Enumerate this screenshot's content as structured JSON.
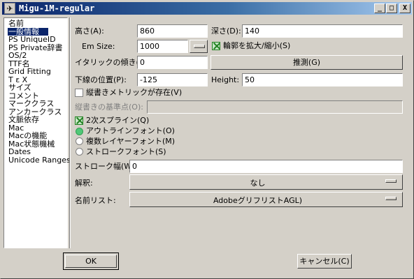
{
  "window": {
    "title": "Migu-1M-regular",
    "icon": "app-icon"
  },
  "titlebar_buttons": {
    "minimize": "_",
    "maximize": "□",
    "close": "X"
  },
  "sidebar": {
    "items": [
      {
        "label": "名前",
        "selected": false
      },
      {
        "label": "一般情報",
        "selected": true
      },
      {
        "label": "PS UniqueID",
        "selected": false
      },
      {
        "label": "PS Private辞書",
        "selected": false
      },
      {
        "label": "OS/2",
        "selected": false
      },
      {
        "label": "TTF名",
        "selected": false
      },
      {
        "label": "Grid Fitting",
        "selected": false
      },
      {
        "label": "T ε X",
        "selected": false
      },
      {
        "label": "サイズ",
        "selected": false
      },
      {
        "label": "コメント",
        "selected": false
      },
      {
        "label": "マーククラス",
        "selected": false
      },
      {
        "label": "アンカークラス",
        "selected": false
      },
      {
        "label": "文脈依存",
        "selected": false
      },
      {
        "label": "Mac",
        "selected": false
      },
      {
        "label": "Macの機能",
        "selected": false
      },
      {
        "label": "Mac状態機械",
        "selected": false
      },
      {
        "label": "Dates",
        "selected": false
      },
      {
        "label": "Unicode Ranges",
        "selected": false
      }
    ]
  },
  "form": {
    "ascent_label": "高さ(A):",
    "ascent_value": "860",
    "descent_label": "深さ(D):",
    "descent_value": "140",
    "em_size_label": "Em Size:",
    "em_size_value": "1000",
    "scale_outlines_label": "輪郭を拡大/縮小(S)",
    "scale_outlines_checked": true,
    "italic_angle_label": "イタリックの傾き(I):",
    "italic_angle_value": "0",
    "guess_button": "推測(G)",
    "underline_pos_label": "下線の位置(P):",
    "underline_pos_value": "-125",
    "height_label": "Height:",
    "height_value": "50",
    "has_vertical_label": "縦書きメトリックが存在(V)",
    "has_vertical_checked": false,
    "vertical_origin_label": "縦書きの基準点(O):",
    "vertical_origin_value": "",
    "quadratic_label": "2次スプライン(Q)",
    "quadratic_checked": true,
    "outline_font_label": "アウトラインフォント(O)",
    "multilayer_font_label": "複数レイヤーフォント(M)",
    "stroke_font_label": "ストロークフォント(S)",
    "font_type_selected": "outline",
    "stroke_width_label": "ストローク幅(W):",
    "stroke_width_value": "0",
    "interpretation_label": "解釈:",
    "interpretation_value": "なし",
    "namelist_label": "名前リスト:",
    "namelist_value": "AdobeグリフリストAGL)"
  },
  "footer": {
    "ok_label": "OK",
    "cancel_label": "キャンセル(C)"
  }
}
